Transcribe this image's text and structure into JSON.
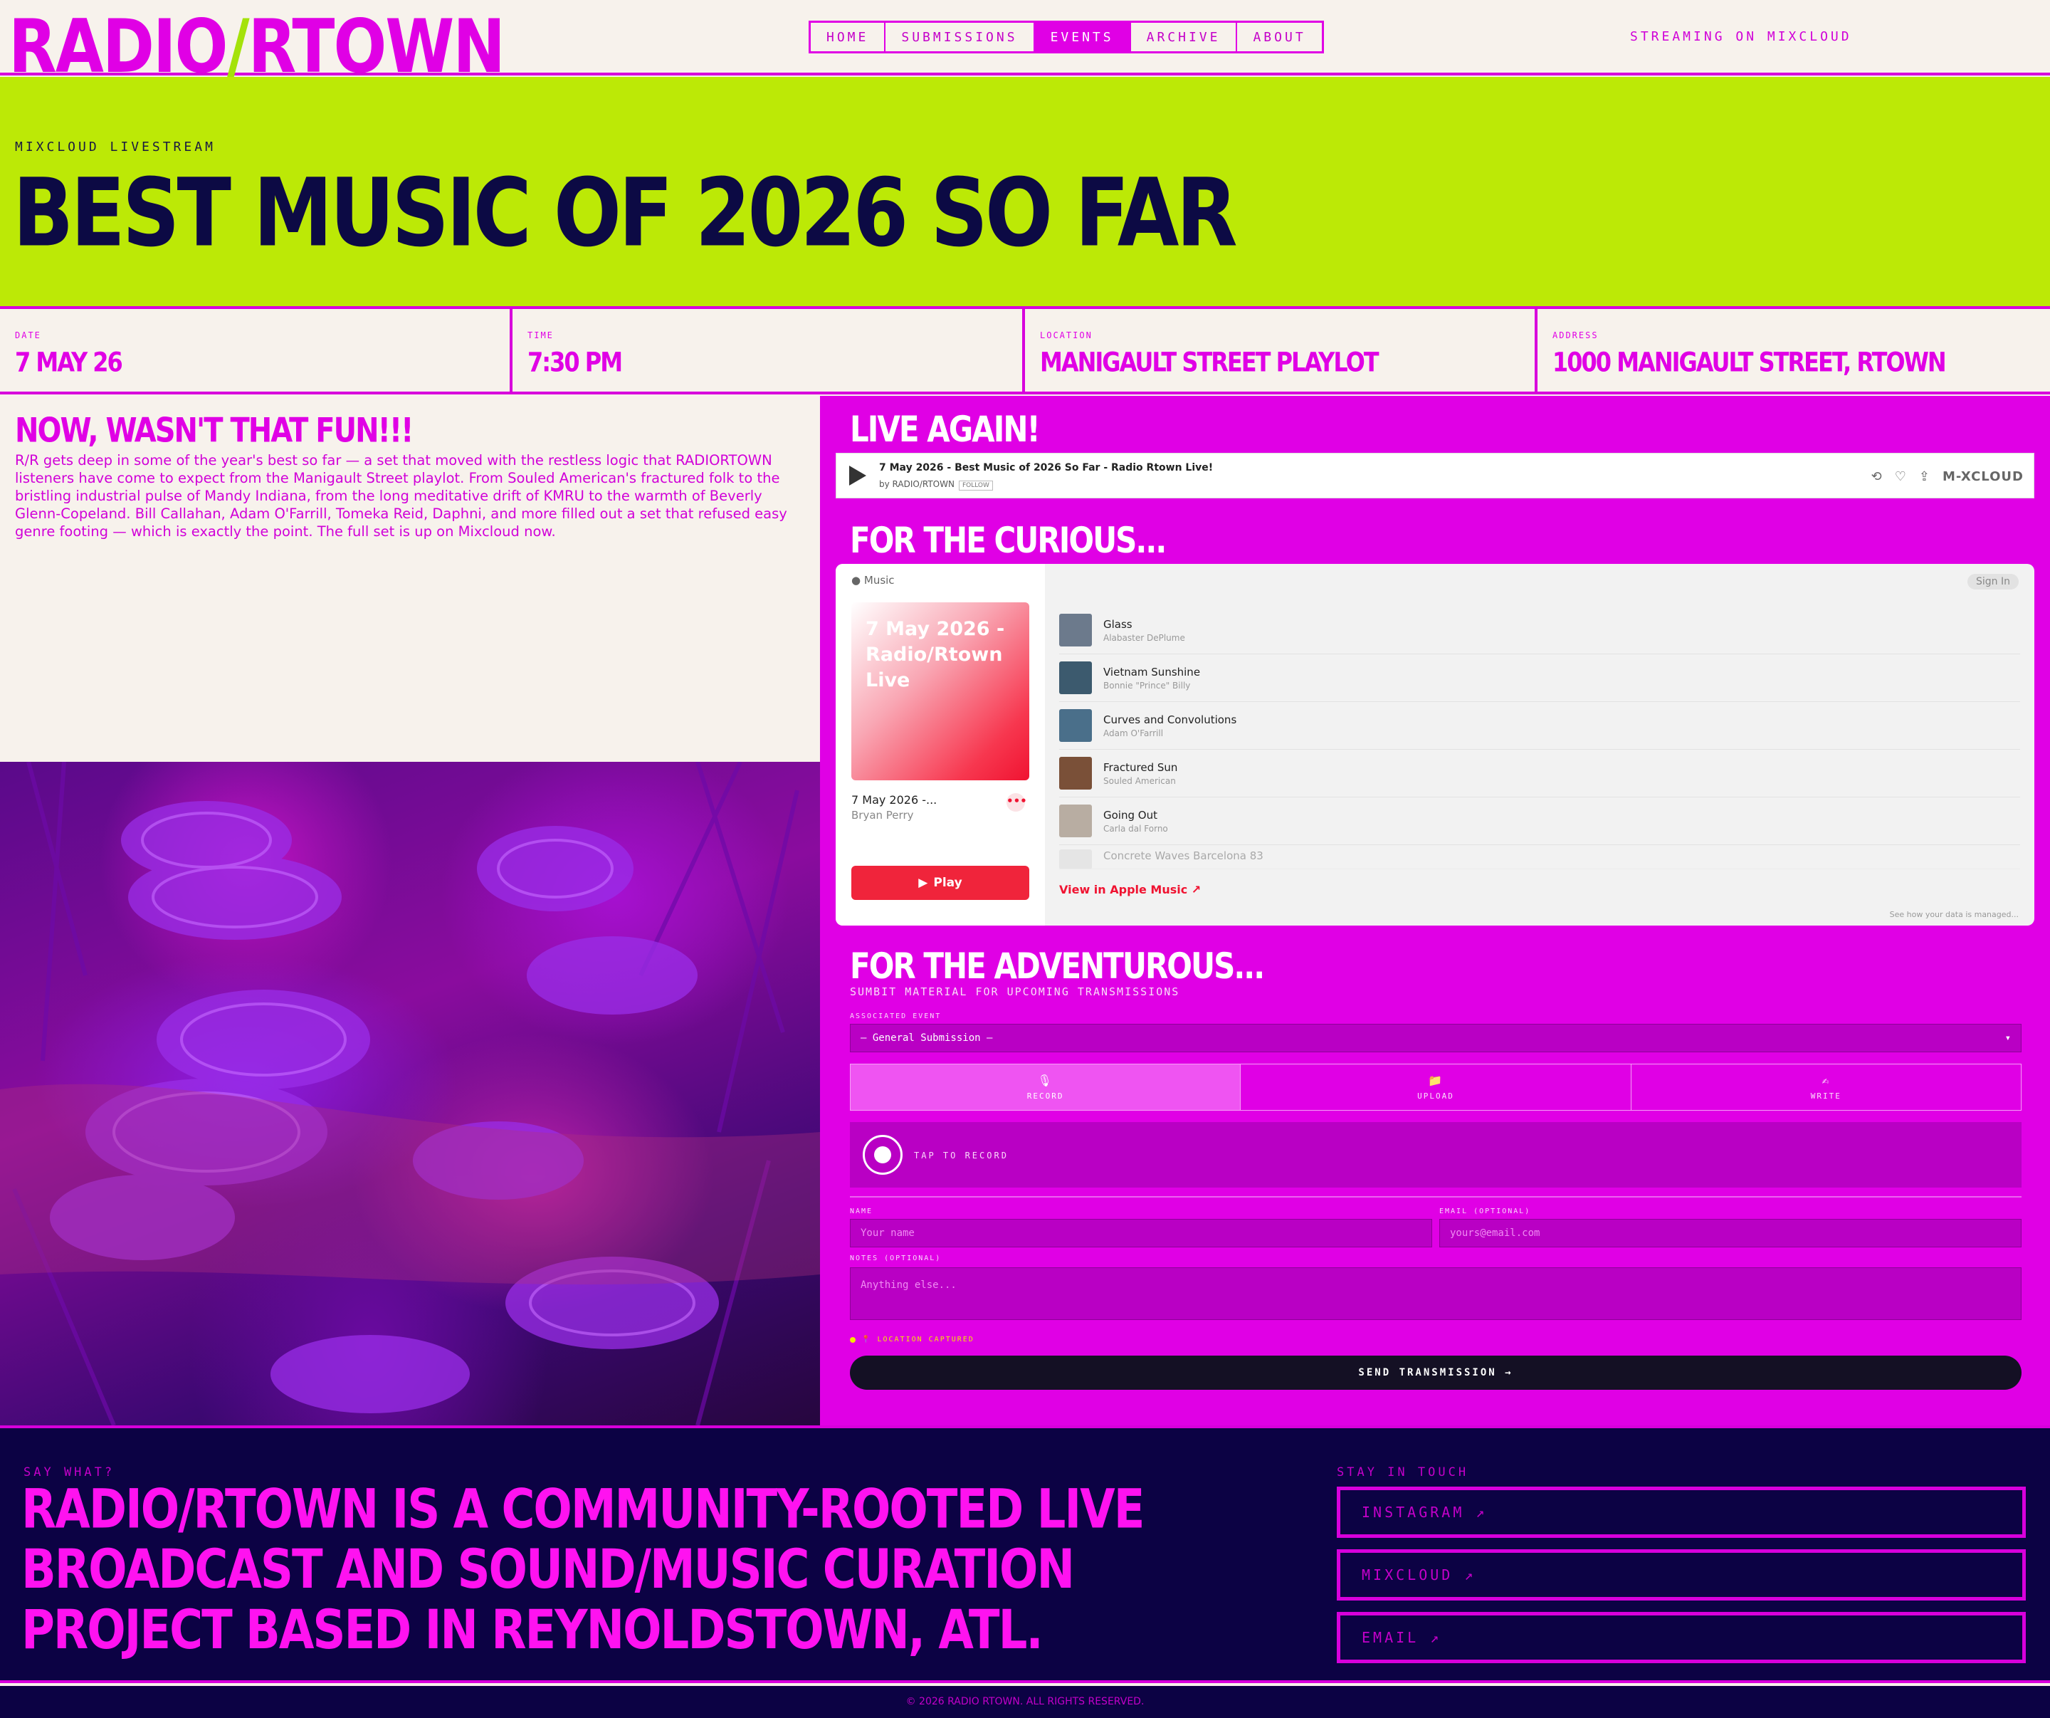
{
  "header": {
    "logo_left": "RADIO",
    "logo_slash": "/",
    "logo_right": "RTOWN",
    "nav": [
      "HOME",
      "SUBMISSIONS",
      "EVENTS",
      "ARCHIVE",
      "ABOUT"
    ],
    "active_nav": "EVENTS",
    "streaming": "STREAMING ON MIXCLOUD"
  },
  "hero": {
    "kicker": "MIXCLOUD LIVESTREAM",
    "title": "BEST MUSIC OF 2026 SO FAR"
  },
  "info": [
    {
      "label": "DATE",
      "value": "7 MAY 26"
    },
    {
      "label": "TIME",
      "value": "7:30 PM"
    },
    {
      "label": "LOCATION",
      "value": "MANIGAULT STREET PLAYLOT"
    },
    {
      "label": "ADDRESS",
      "value": "1000 MANIGAULT STREET, RTOWN"
    }
  ],
  "recap": {
    "heading": "NOW, WASN'T THAT FUN!!!",
    "body": "R/R gets deep in some of the year's best so far — a set that moved with the restless logic that RADIORTOWN listeners have come to expect from the Manigault Street playlot. From Souled American's fractured folk to the bristling industrial pulse of Mandy Indiana, from the long meditative drift of KMRU to the warmth of Beverly Glenn-Copeland. Bill Callahan, Adam O'Farrill, Tomeka Reid, Daphni, and more filled out a set that refused easy genre footing — which is exactly the point. The full set is up on Mixcloud now."
  },
  "live_again": {
    "heading": "LIVE AGAIN!",
    "mixcloud": {
      "title": "7 May 2026 - Best Music of 2026 So Far - Radio Rtown Live!",
      "by_prefix": "by",
      "by": "RADIO/RTOWN",
      "follow": "FOLLOW",
      "logo": "M-XCLOUD"
    }
  },
  "curious": {
    "heading": "FOR THE CURIOUS...",
    "apple": {
      "brand": "Music",
      "art_text": "7 May 2026 - Radio/Rtown Live",
      "album": "7 May 2026 -...",
      "artist": "Bryan Perry",
      "more": "•••",
      "play": "Play",
      "sign_in": "Sign In",
      "view": "View in Apple Music ↗",
      "data_note": "See how your data is managed...",
      "tracks": [
        {
          "name": "Glass",
          "artist": "Alabaster DePlume",
          "color": "#6c7a8c"
        },
        {
          "name": "Vietnam Sunshine",
          "artist": "Bonnie \"Prince\" Billy",
          "color": "#3c5a6e"
        },
        {
          "name": "Curves and Convolutions",
          "artist": "Adam O'Farrill",
          "color": "#4a6f8a"
        },
        {
          "name": "Fractured Sun",
          "artist": "Souled American",
          "color": "#7a5038"
        },
        {
          "name": "Going Out",
          "artist": "Carla dal Forno",
          "color": "#b8ada2"
        },
        {
          "name": "Concrete Waves Barcelona 83",
          "artist": "",
          "color": "#cfcfcf"
        }
      ]
    }
  },
  "adventurous": {
    "heading": "FOR THE ADVENTUROUS...",
    "subhead": "SUMBIT MATERIAL FOR UPCOMING TRANSMISSIONS",
    "event_label": "ASSOCIATED EVENT",
    "event_value": "— General Submission —",
    "tabs": [
      {
        "label": "RECORD",
        "icon": "🎙"
      },
      {
        "label": "UPLOAD",
        "icon": "📁"
      },
      {
        "label": "WRITE",
        "icon": "✍"
      }
    ],
    "tap_to_record": "TAP TO RECORD",
    "name_label": "NAME",
    "name_placeholder": "Your name",
    "email_label": "EMAIL (OPTIONAL)",
    "email_placeholder": "yours@email.com",
    "notes_label": "NOTES (OPTIONAL)",
    "notes_placeholder": "Anything else...",
    "location": "📍 LOCATION CAPTURED",
    "send": "SEND TRANSMISSION →"
  },
  "footer": {
    "say": "SAY WHAT?",
    "mission": "RADIO/RTOWN IS A COMMUNITY-ROOTED LIVE BROADCAST AND SOUND/MUSIC CURATION PROJECT BASED IN REYNOLDSTOWN, ATL.",
    "stay": "STAY IN TOUCH",
    "links": [
      "INSTAGRAM ↗",
      "MIXCLOUD ↗",
      "EMAIL ↗"
    ],
    "copyright": "© 2026 RADIO RTOWN. ALL RIGHTS RESERVED."
  },
  "colors": {
    "magenta": "#e000e5",
    "lime": "#bce906",
    "navy": "#0c0244",
    "cream": "#f7f2ec"
  }
}
